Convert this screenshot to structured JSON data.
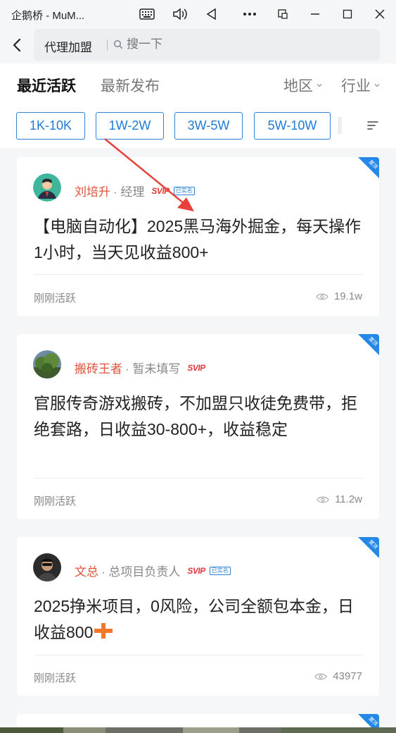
{
  "window": {
    "title": "企鹅桥 - MuM...",
    "icons": [
      "keyboard-icon",
      "volume-icon",
      "back-triangle-icon",
      "more-icon",
      "screen-icon",
      "minimize-icon",
      "maximize-icon",
      "close-icon"
    ]
  },
  "header": {
    "category": "代理加盟",
    "search_placeholder": "搜一下"
  },
  "tabs": {
    "recent": "最近活跃",
    "newest": "最新发布",
    "region": "地区",
    "industry": "行业"
  },
  "chips": [
    "1K-10K",
    "1W-2W",
    "3W-5W",
    "5W-10W"
  ],
  "colors": {
    "accent_blue": "#1f7ad6",
    "name_red": "#e0533e",
    "ribbon_blue": "#2688e6",
    "arrow_red": "#e8403a"
  },
  "posts": [
    {
      "name": "刘培升",
      "role": "· 经理",
      "badge": "SVIP",
      "verified": "已实名",
      "title": "【电脑自动化】2025黑马海外掘金，每天操作1小时，当天见收益800+",
      "status": "刚刚活跃",
      "views": "19.1w",
      "ribbon": "置顶"
    },
    {
      "name": "搬砖王者",
      "role": "· 暂未填写",
      "badge": "SVIP",
      "title": "官服传奇游戏搬砖，不加盟只收徒免费带，拒绝套路，日收益30-800+，收益稳定",
      "status": "刚刚活跃",
      "views": "11.2w",
      "ribbon": "置顶"
    },
    {
      "name": "文总",
      "role": "· 总项目负责人",
      "badge": "SVIP",
      "verified": "已实名",
      "title": "2025挣米项目，0风险，公司全额包本金，日收益800",
      "status": "刚刚活跃",
      "views": "43977",
      "ribbon": "置顶"
    },
    {
      "ribbon": "置顶"
    }
  ]
}
